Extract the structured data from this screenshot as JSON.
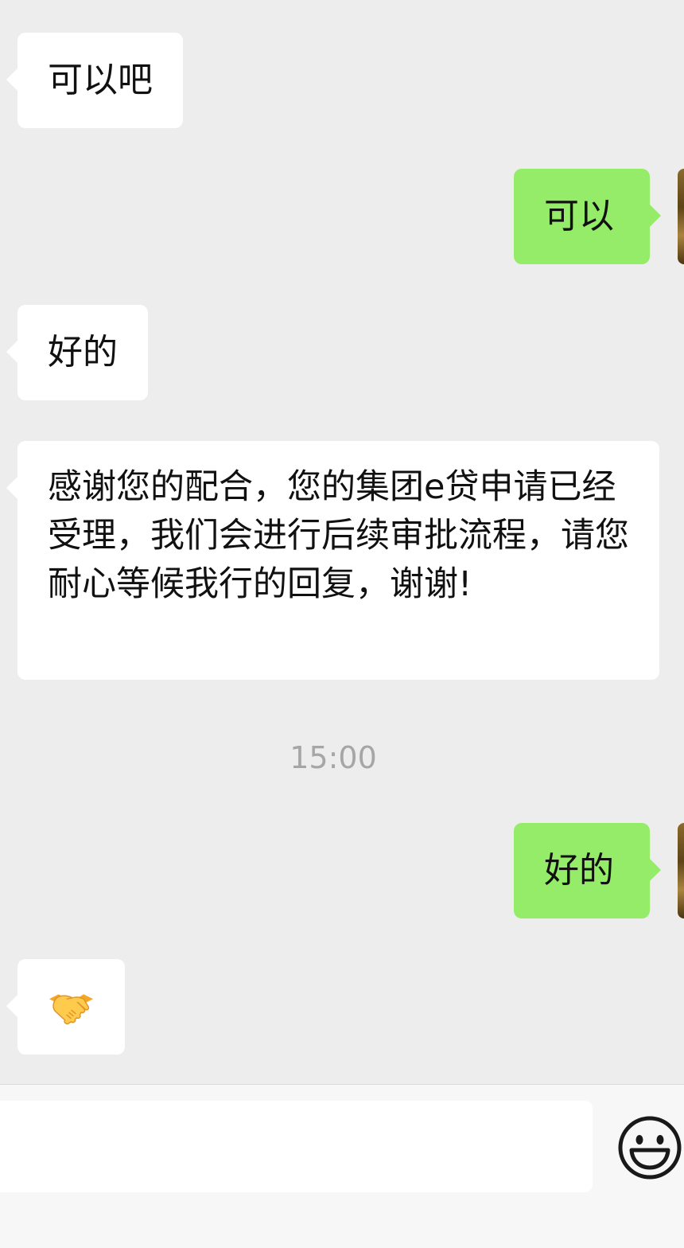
{
  "messages": [
    {
      "side": "incoming",
      "text": "可以吧"
    },
    {
      "side": "outgoing",
      "text": "可以"
    },
    {
      "side": "incoming",
      "text": "好的"
    },
    {
      "side": "incoming",
      "text": "感谢您的配合，您的集团e贷申请已经受理，我们会进行后续审批流程，请您耐心等候我行的回复，谢谢!"
    },
    {
      "side": "outgoing",
      "text": "好的"
    },
    {
      "side": "incoming",
      "text": "",
      "icon": "handshake-emoji"
    }
  ],
  "timestamp": "15:00",
  "input_bar": {
    "placeholder": "",
    "emoji_button_icon": "smiley-face-icon"
  },
  "colors": {
    "background": "#ededed",
    "incoming_bubble": "#ffffff",
    "outgoing_bubble": "#95ec69",
    "timestamp_text": "#a6a6a6"
  }
}
